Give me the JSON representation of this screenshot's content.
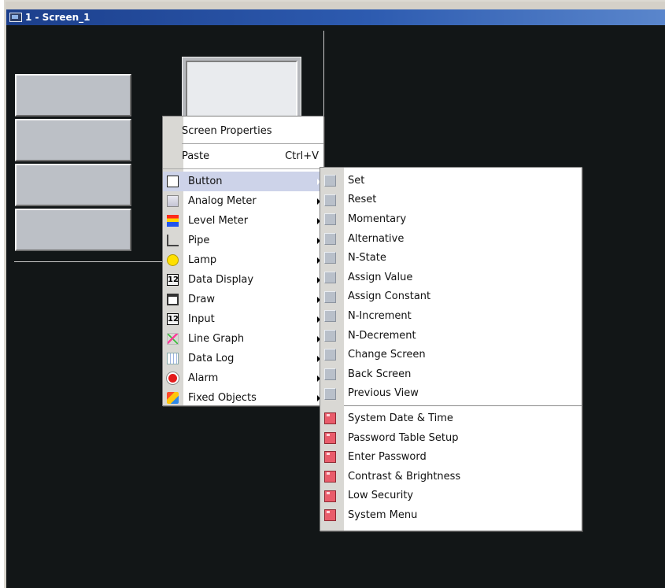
{
  "window": {
    "title": "1 - Screen_1"
  },
  "colors": {
    "canvas_bg": "#121617",
    "menu_bg": "#ffffff",
    "highlight": "#cdd3e9",
    "titlebar": "#2d5bb0"
  },
  "context_menu": {
    "screen_properties": "Screen Properties",
    "paste": "Paste",
    "paste_shortcut": "Ctrl+V",
    "items": [
      {
        "label": "Button",
        "icon": "button-icon"
      },
      {
        "label": "Analog Meter",
        "icon": "analog-meter-icon"
      },
      {
        "label": "Level Meter",
        "icon": "level-meter-icon"
      },
      {
        "label": "Pipe",
        "icon": "pipe-icon"
      },
      {
        "label": "Lamp",
        "icon": "lamp-icon"
      },
      {
        "label": "Data Display",
        "icon": "data-display-icon",
        "glyph": "12"
      },
      {
        "label": "Draw",
        "icon": "draw-icon"
      },
      {
        "label": "Input",
        "icon": "input-icon",
        "glyph": "12"
      },
      {
        "label": "Line Graph",
        "icon": "line-graph-icon"
      },
      {
        "label": "Data Log",
        "icon": "data-log-icon"
      },
      {
        "label": "Alarm",
        "icon": "alarm-icon"
      },
      {
        "label": "Fixed Objects",
        "icon": "fixed-objects-icon"
      }
    ]
  },
  "submenu": {
    "button_types": [
      "Set",
      "Reset",
      "Momentary",
      "Alternative",
      "N-State",
      "Assign Value",
      "Assign Constant",
      "N-Increment",
      "N-Decrement",
      "Change Screen",
      "Back Screen",
      "Previous View"
    ],
    "system_buttons": [
      "System Date & Time",
      "Password Table Setup",
      "Enter Password",
      "Contrast & Brightness",
      "Low Security",
      "System Menu"
    ]
  }
}
